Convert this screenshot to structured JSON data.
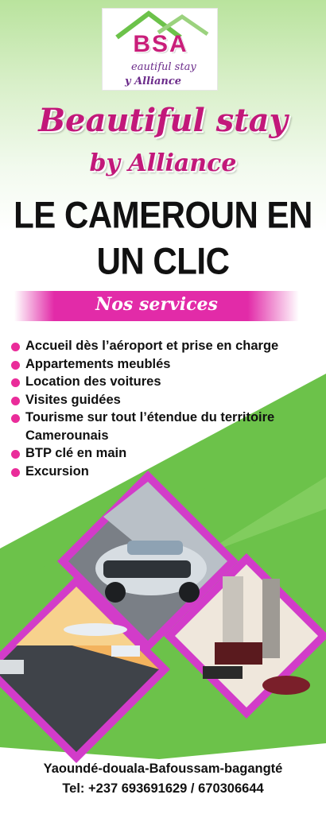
{
  "logo": {
    "mark": "BSA",
    "line1": "eautiful stay",
    "line2": "y Alliance"
  },
  "title": {
    "line1": "Beautiful stay",
    "line2": "by Alliance"
  },
  "headline": {
    "line1": "LE CAMEROUN EN",
    "line2": "UN CLIC"
  },
  "banner": {
    "label": "Nos services"
  },
  "services": [
    "Accueil dès l’aéroport et prise en charge",
    "Appartements meublés",
    "Location des voitures",
    "Visites guidées",
    "Tourisme sur tout l’étendue du territoire Camerounais",
    "BTP clé en main",
    "Excursion"
  ],
  "footer": {
    "cities": "Yaoundé-douala-Bafoussam-bagangté",
    "phone": "Tel: +237 693691629 / 670306644"
  },
  "colors": {
    "brand_pink": "#e22ba8",
    "brand_green": "#6cc24a",
    "text": "#111111"
  }
}
